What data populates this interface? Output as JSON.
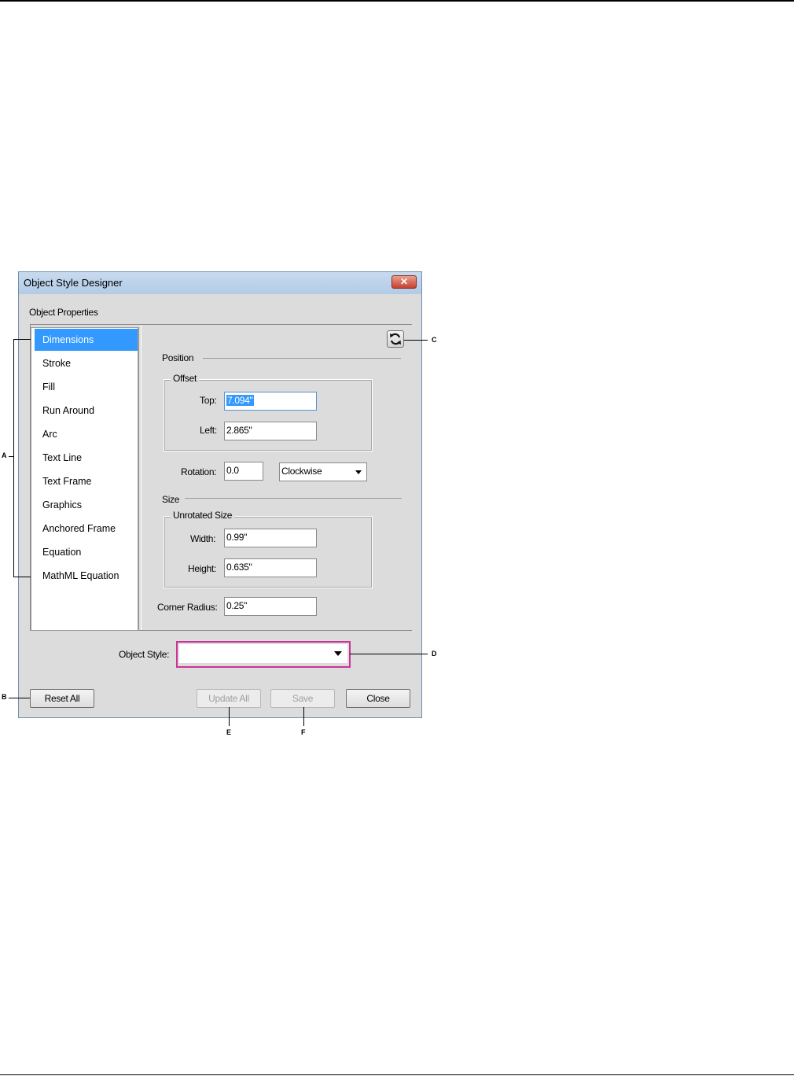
{
  "window": {
    "title": "Object Style Designer",
    "close_glyph": "✕"
  },
  "properties_label": "Object Properties",
  "categories": [
    {
      "label": "Dimensions",
      "selected": true
    },
    {
      "label": "Stroke"
    },
    {
      "label": "Fill"
    },
    {
      "label": "Run Around"
    },
    {
      "label": "Arc"
    },
    {
      "label": "Text Line"
    },
    {
      "label": "Text Frame"
    },
    {
      "label": "Graphics"
    },
    {
      "label": "Anchored Frame"
    },
    {
      "label": "Equation"
    },
    {
      "label": "MathML Equation"
    }
  ],
  "position": {
    "section": "Position",
    "offset_group": "Offset",
    "top_label": "Top:",
    "top_value": "7.094\"",
    "left_label": "Left:",
    "left_value": "2.865\"",
    "rotation_label": "Rotation:",
    "rotation_value": "0.0",
    "direction_value": "Clockwise"
  },
  "size": {
    "section": "Size",
    "unrotated_group": "Unrotated Size",
    "width_label": "Width:",
    "width_value": "0.99\"",
    "height_label": "Height:",
    "height_value": "0.635\"",
    "corner_label": "Corner Radius:",
    "corner_value": "0.25\""
  },
  "object_style": {
    "label": "Object Style:",
    "value": ""
  },
  "buttons": {
    "reset_all": "Reset All",
    "update_all": "Update All",
    "save": "Save",
    "close": "Close"
  },
  "callouts": {
    "a": "A",
    "b": "B",
    "c": "C",
    "d": "D",
    "e": "E",
    "f": "F"
  },
  "icons": {
    "refresh": "refresh-icon",
    "close": "close-icon",
    "dropdown": "chevron-down-icon"
  },
  "colors": {
    "selection": "#3399ff",
    "highlight": "#cc3399"
  }
}
